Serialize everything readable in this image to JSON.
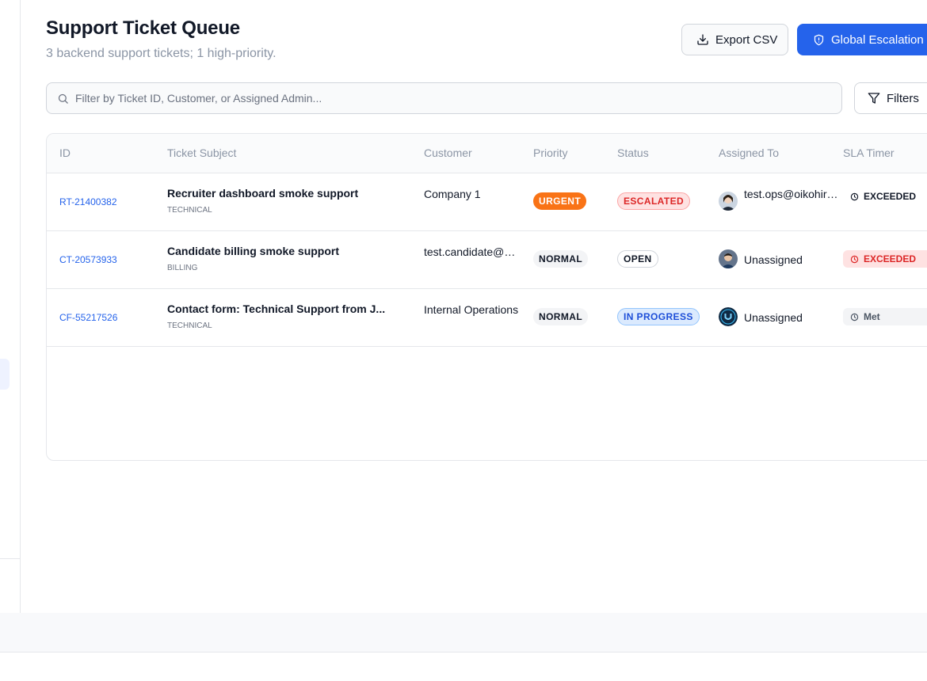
{
  "header": {
    "title": "Support Ticket Queue",
    "subtitle": "3 backend support tickets; 1 high-priority.",
    "export_label": "Export CSV",
    "escalation_label": "Global Escalation"
  },
  "search": {
    "placeholder": "Filter by Ticket ID, Customer, or Assigned Admin...",
    "filters_label": "Filters"
  },
  "table": {
    "columns": [
      "ID",
      "Ticket Subject",
      "Customer",
      "Priority",
      "Status",
      "Assigned To",
      "SLA Timer"
    ],
    "rows": [
      {
        "id": "RT-21400382",
        "subject": "Recruiter dashboard smoke support",
        "category": "TECHNICAL",
        "customer": "Company 1",
        "priority": "URGENT",
        "status": "ESCALATED",
        "assigned": "test.ops@oikohire.com",
        "sla": "EXCEEDED"
      },
      {
        "id": "CT-20573933",
        "subject": "Candidate billing smoke support",
        "category": "BILLING",
        "customer": "test.candidate@oikohire.com",
        "priority": "NORMAL",
        "status": "OPEN",
        "assigned": "Unassigned",
        "sla": "EXCEEDED"
      },
      {
        "id": "CF-55217526",
        "subject": "Contact form: Technical Support from J...",
        "category": "TECHNICAL",
        "customer": "Internal Operations",
        "priority": "NORMAL",
        "status": "IN PROGRESS",
        "assigned": "Unassigned",
        "sla": "Met"
      }
    ]
  },
  "colors": {
    "primary": "#2563eb",
    "urgent": "#f97316",
    "danger": "#dc2626",
    "muted": "#8b95a5"
  }
}
